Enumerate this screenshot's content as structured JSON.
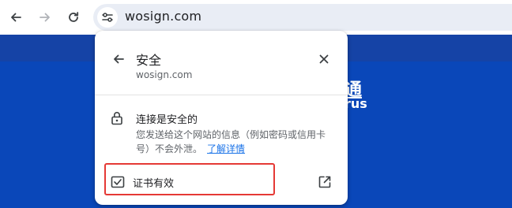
{
  "toolbar": {
    "back_icon": "arrow-left-icon",
    "forward_icon": "arrow-right-icon",
    "reload_icon": "reload-icon",
    "site_info_icon": "tune-icon",
    "url": "wosign.com"
  },
  "page": {
    "partial_heading": "通",
    "partial_subheading": "rus",
    "background_color": "#0a47b9"
  },
  "site_info_popup": {
    "back_icon": "arrow-left-icon",
    "title": "安全",
    "domain": "wosign.com",
    "close_icon": "close-icon",
    "connection": {
      "icon": "lock-icon",
      "title": "连接是安全的",
      "description": "您发送给这个网站的信息（例如密码或信用卡号）不会外泄。",
      "link_label": "了解详情"
    },
    "certificate": {
      "icon": "certificate-icon",
      "label": "证书有效",
      "external_icon": "open-in-new-icon"
    }
  },
  "annotation": {
    "highlight_color": "#e53935"
  }
}
